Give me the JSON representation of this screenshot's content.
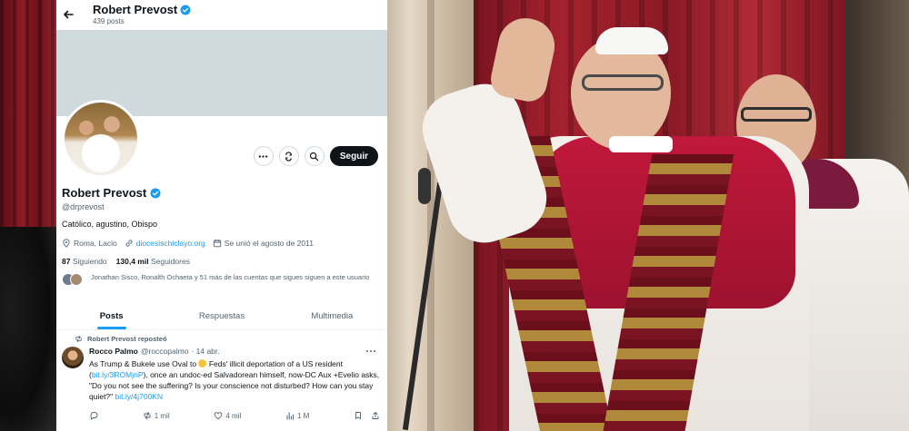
{
  "header": {
    "name": "Robert Prevost",
    "posts_count": "439 posts"
  },
  "profile": {
    "name": "Robert Prevost",
    "handle": "@drprevost",
    "bio": "Católico, agustino, Obispo",
    "location": "Roma, Lacio",
    "website": "diocesischiclayo.org",
    "joined": "Se unió el agosto de 2011",
    "following_count": "87",
    "following_label": "Siguiendo",
    "followers_count": "130,4 mil",
    "followers_label": "Seguidores",
    "followed_by": "Jonathan Sisco, Ronalth Ochaeta y 51 más de las cuentas que sigues siguen a este usuario",
    "follow_button": "Seguir"
  },
  "tabs": [
    {
      "label": "Posts",
      "active": true
    },
    {
      "label": "Respuestas",
      "active": false
    },
    {
      "label": "Multimedia",
      "active": false
    }
  ],
  "tweet": {
    "repost_label": "Robert Prevost reposteó",
    "author": "Rocco Palmo",
    "handle": "@roccopalmo",
    "date": "· 14 abr.",
    "text_1": "As Trump & Bukele use Oval to",
    "text_2": "Feds' illicit deportation of a US resident (",
    "link_1": "bit.ly/3ROMjnP",
    "text_3": "), once an undoc-ed Salvadorean himself, now-DC Aux +Evelio asks, \"Do you not see the suffering? Is your conscience not disturbed? How can you stay quiet?\"",
    "link_2": "bit.ly/4j700KN",
    "reposts": "1 mil",
    "likes": "4 mil",
    "views": "1 M"
  },
  "icons": {
    "verified": "verified-badge-icon",
    "back": "back-arrow-icon",
    "more": "more-dots-icon",
    "rss": "notifications-icon",
    "search": "search-icon"
  },
  "colors": {
    "accent": "#1d9bf0",
    "text": "#0f1419",
    "muted": "#536471",
    "banner": "#cfd9de"
  }
}
